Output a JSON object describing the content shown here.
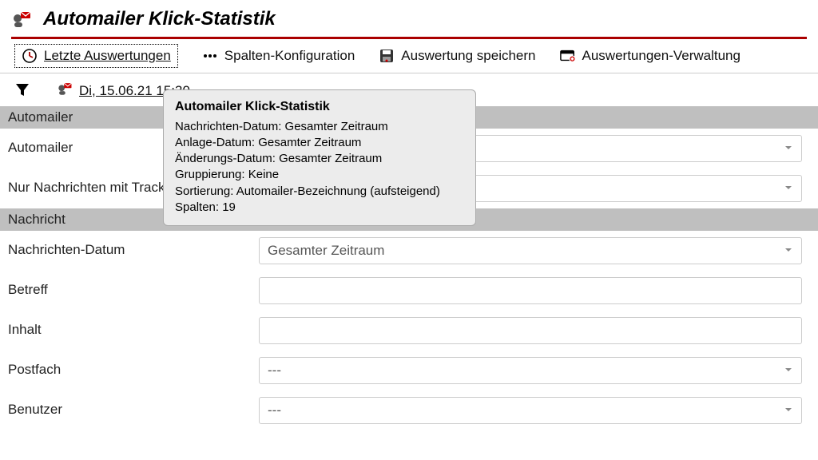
{
  "page_title": "Automailer Klick-Statistik",
  "toolbar": {
    "last_reports": "Letzte Auswertungen",
    "columns_config": "Spalten-Konfiguration",
    "save_report": "Auswertung speichern",
    "reports_admin": "Auswertungen-Verwaltung"
  },
  "history": {
    "latest_label": "Di, 15.06.21 15:30"
  },
  "tooltip": {
    "title": "Automailer Klick-Statistik",
    "lines": [
      "Nachrichten-Datum: Gesamter Zeitraum",
      "Anlage-Datum: Gesamter Zeitraum",
      "Änderungs-Datum: Gesamter Zeitraum",
      "Gruppierung: Keine",
      "Sortierung: Automailer-Bezeichnung (aufsteigend)",
      "Spalten: 19"
    ]
  },
  "sections": {
    "automailer": {
      "header": "Automailer",
      "rows": {
        "automailer_label": "Automailer",
        "tracking_only_label": "Nur Nachrichten mit Tracking"
      }
    },
    "nachricht": {
      "header": "Nachricht",
      "rows": {
        "date_label": "Nachrichten-Datum",
        "date_value": "Gesamter Zeitraum",
        "subject_label": "Betreff",
        "content_label": "Inhalt",
        "mailbox_label": "Postfach",
        "mailbox_value": "---",
        "user_label": "Benutzer",
        "user_value": "---"
      }
    }
  }
}
